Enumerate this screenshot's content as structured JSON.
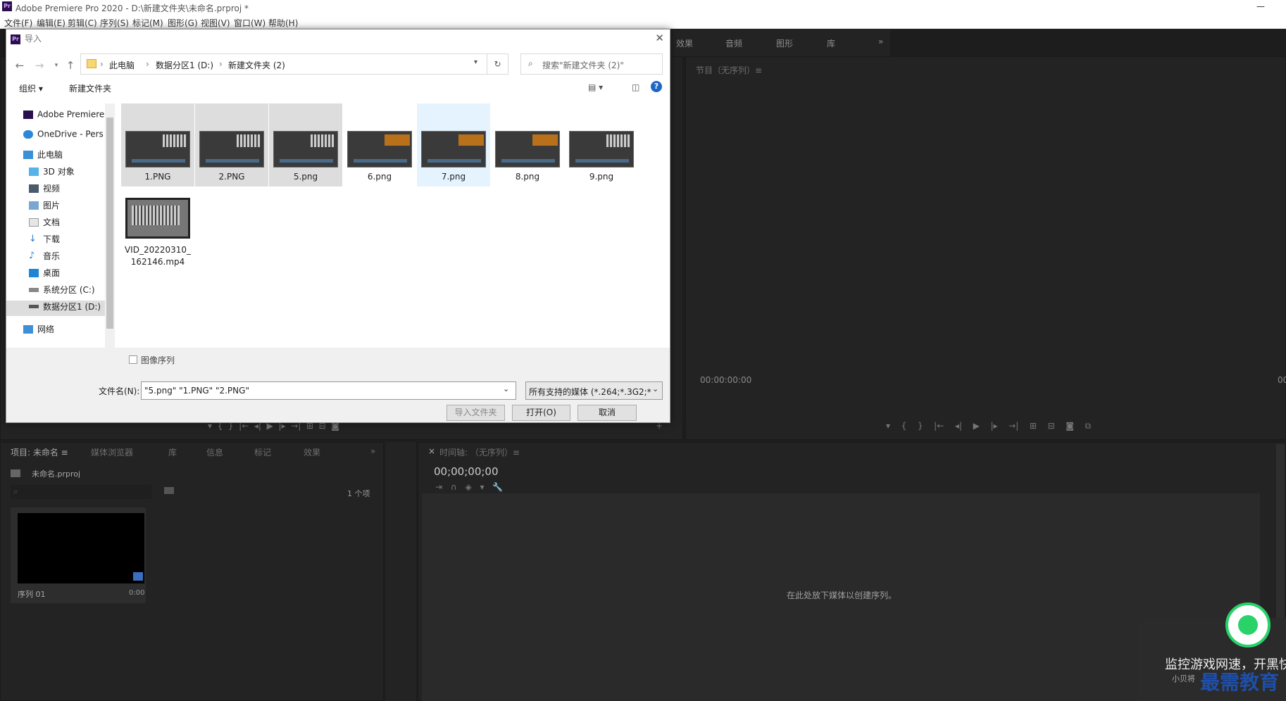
{
  "app": {
    "title": "Adobe Premiere Pro 2020 - D:\\新建文件夹\\未命名.prproj *",
    "pr_logo": "Pr"
  },
  "menu": [
    "文件(F)",
    "编辑(E)",
    "剪辑(C)",
    "序列(S)",
    "标记(M)",
    "图形(G)",
    "视图(V)",
    "窗口(W)",
    "帮助(H)"
  ],
  "top_tabs": {
    "effects": "效果",
    "audio": "音频",
    "graphics": "图形",
    "library": "库",
    "more": "»"
  },
  "program_monitor": {
    "title": "节目（无序列）≡",
    "timecode_left": "00:00:00:00",
    "timecode_right": "00"
  },
  "project_panel": {
    "tabs": [
      "项目: 未命名 ≡",
      "媒体浏览器",
      "库",
      "信息",
      "标记",
      "效果"
    ],
    "more": "»",
    "file": "未命名.prproj",
    "count": "1 个项",
    "item_name": "序列 01",
    "item_duration": "0:00"
  },
  "timeline": {
    "close": "×",
    "title": "时间轴: （无序列）≡",
    "timecode": "00;00;00;00",
    "empty_msg": "在此处放下媒体以创建序列。"
  },
  "dialog": {
    "title": "导入",
    "path": [
      "此电脑",
      "数据分区1 (D:)",
      "新建文件夹 (2)"
    ],
    "search_placeholder": "搜索\"新建文件夹 (2)\"",
    "organize": "组织 ▾",
    "new_folder": "新建文件夹",
    "nav": [
      "Adobe Premiere",
      "OneDrive - Pers",
      "此电脑",
      "3D 对象",
      "视频",
      "图片",
      "文档",
      "下载",
      "音乐",
      "桌面",
      "系统分区 (C:)",
      "数据分区1 (D:)",
      "网络"
    ],
    "files": [
      {
        "name": "1.PNG",
        "state": "selected",
        "thumb": "keyboard"
      },
      {
        "name": "2.PNG",
        "state": "selected",
        "thumb": "keyboard"
      },
      {
        "name": "5.png",
        "state": "selected",
        "thumb": "keyboard"
      },
      {
        "name": "6.png",
        "state": "none",
        "thumb": "orange"
      },
      {
        "name": "7.png",
        "state": "hover",
        "thumb": "orange"
      },
      {
        "name": "8.png",
        "state": "none",
        "thumb": "orange"
      },
      {
        "name": "9.png",
        "state": "none",
        "thumb": "keyboard"
      },
      {
        "name": "VID_20220310_\n162146.mp4",
        "state": "none",
        "thumb": "video"
      }
    ],
    "image_sequence_label": "图像序列",
    "filename_label": "文件名(N):",
    "filename_value": "\"5.png\" \"1.PNG\" \"2.PNG\"",
    "filetype_value": "所有支持的媒体 (*.264;*.3G2;*",
    "import_folder": "导入文件夹",
    "open": "打开(O)",
    "cancel": "取消",
    "help": "?"
  },
  "notification": {
    "title": "监控游戏网速，开黑快",
    "subtitle": "小贝将",
    "badge": "最需教育"
  },
  "colors": {
    "accent": "#0078d7",
    "selected": "#dddddd",
    "hover": "#e5f3ff",
    "panel": "#232323"
  }
}
